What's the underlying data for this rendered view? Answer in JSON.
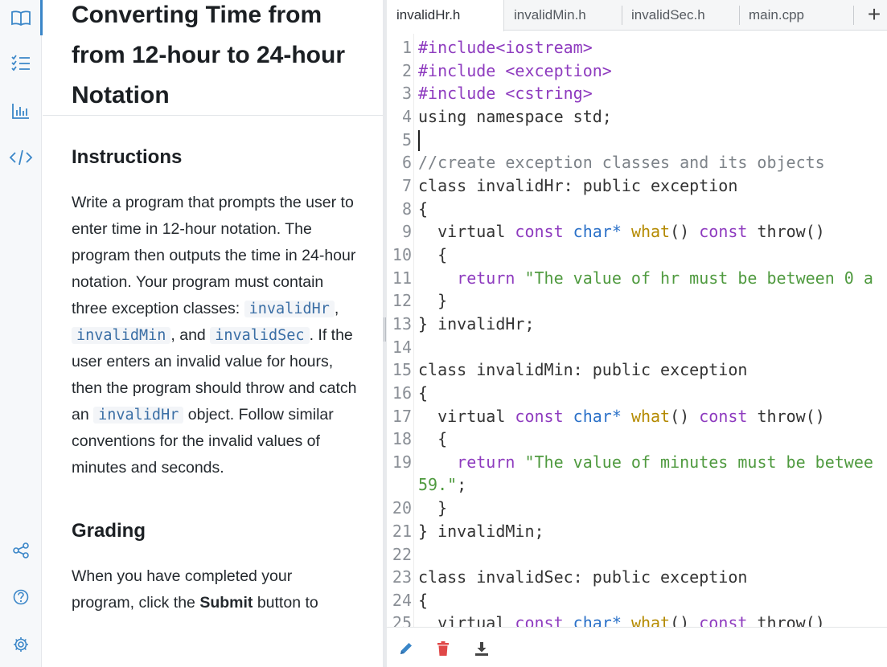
{
  "rail": {
    "icons": [
      "book-icon",
      "list-icon",
      "chart-icon",
      "code-icon",
      "share-icon",
      "help-icon",
      "settings-icon"
    ]
  },
  "lesson": {
    "title": "Converting Time from from 12-hour to 24-hour Notation",
    "instructions_heading": "Instructions",
    "instructions": {
      "t1": "Write a program that prompts the user to enter time in 12-hour notation. The program then outputs the time in 24-hour notation. Your program must contain three exception classes: ",
      "c1": "invalidHr",
      "t2": ", ",
      "c2": "invalidMin",
      "t3": ", and ",
      "c3": "invalidSec",
      "t4": ". If the user enters an invalid value for hours, then the program should throw and catch an ",
      "c4": "invalidHr",
      "t5": " object. Follow similar conventions for the invalid values of minutes and seconds."
    },
    "grading_heading": "Grading",
    "grading": {
      "t1": "When you have completed your program, click the ",
      "bold": "Submit",
      "t2": " button to"
    }
  },
  "editor": {
    "tabs": [
      "invalidHr.h",
      "invalidMin.h",
      "invalidSec.h",
      "main.cpp"
    ],
    "active_tab": "invalidHr.h",
    "add_tab_label": "+",
    "line_numbers": [
      "1",
      "2",
      "3",
      "4",
      "5",
      "6",
      "7",
      "8",
      "9",
      "10",
      "11",
      "12",
      "13",
      "14",
      "15",
      "16",
      "17",
      "18",
      "19",
      "",
      "20",
      "21",
      "22",
      "23",
      "24",
      "25"
    ],
    "code": {
      "l1a": "#include",
      "l1b": "<iostream>",
      "l2a": "#include ",
      "l2b": "<exception>",
      "l3a": "#include ",
      "l3b": "<cstring>",
      "l4": "using namespace std;",
      "l6": "//create exception classes and its objects",
      "l7a": "class invalidHr: public exception",
      "l8": "{",
      "l9a": "  virtual ",
      "l9b": "const ",
      "l9c": "char",
      "l9d": "* ",
      "l9e": "what",
      "l9f": "() ",
      "l9g": "const ",
      "l9h": "throw()",
      "l10": "  {",
      "l11a": "    return ",
      "l11b": "\"The value of hr must be between 0 a",
      "l12": "  }",
      "l13": "} invalidHr;",
      "l15": "class invalidMin: public exception",
      "l16": "{",
      "l17a": "  virtual ",
      "l17b": "const ",
      "l17c": "char",
      "l17d": "* ",
      "l17e": "what",
      "l17f": "() ",
      "l17g": "const ",
      "l17h": "throw()",
      "l18": "  {",
      "l19a": "    return ",
      "l19b": "\"The value of minutes must be betwee",
      "l19c": "59.\"",
      "l19d": ";",
      "l20": "  }",
      "l21": "} invalidMin;",
      "l23": "class invalidSec: public exception",
      "l24": "{",
      "l25a": "  virtual ",
      "l25b": "const ",
      "l25c": "char",
      "l25d": "* ",
      "l25e": "what",
      "l25f": "() ",
      "l25g": "const ",
      "l25h": "throw()"
    }
  },
  "footer": {
    "icons": [
      "pencil-icon",
      "trash-icon",
      "download-icon"
    ],
    "colors": {
      "pencil": "#3a86c8",
      "trash": "#e04848",
      "download": "#444444"
    }
  }
}
